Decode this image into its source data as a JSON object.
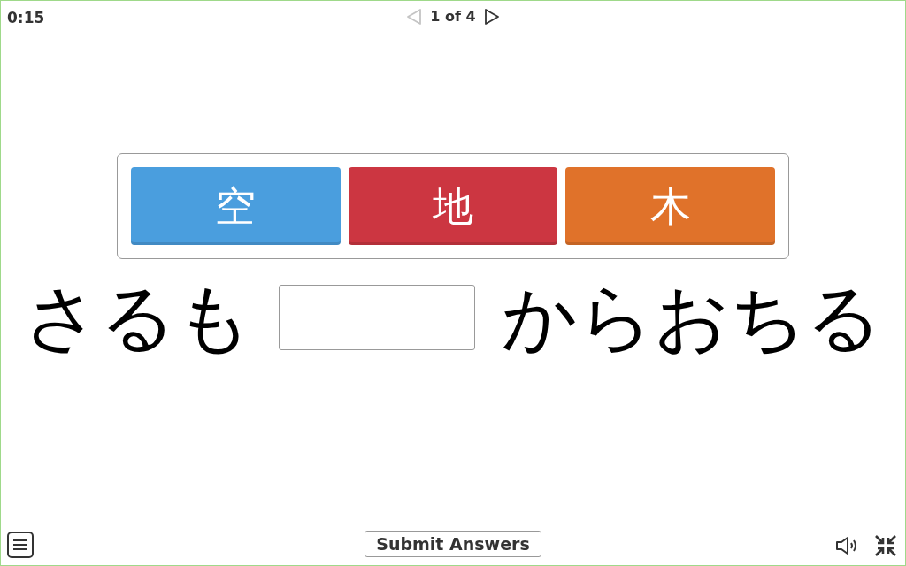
{
  "timer": "0:15",
  "pager": {
    "label": "1 of 4",
    "prev_disabled": true,
    "next_disabled": false
  },
  "choices": [
    {
      "label": "空",
      "color": "#4a9ede"
    },
    {
      "label": "地",
      "color": "#cc3641"
    },
    {
      "label": "木",
      "color": "#e0722a"
    }
  ],
  "sentence": {
    "before": "さるも",
    "after": "からおちる"
  },
  "submit_button": "Submit Answers"
}
